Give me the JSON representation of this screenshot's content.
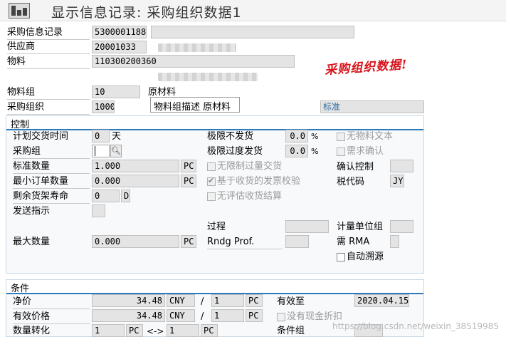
{
  "window": {
    "title": "显示信息记录: 采购组织数据1"
  },
  "header": {
    "info_record_label": "采购信息记录",
    "info_record_value": "5300001188",
    "vendor_label": "供应商",
    "vendor_value": "20001033",
    "material_label": "物料",
    "material_value": "110300200360",
    "material_group_label": "物料组",
    "material_group_value": "10",
    "material_group_desc": "原材料",
    "purch_org_label": "采购组织",
    "purch_org_value": "1000",
    "purch_org_type": "标准",
    "annotation": "采购组织数据!",
    "tooltip": "物料组描述 原材料"
  },
  "control": {
    "section_title": "控制",
    "planned_delivery_label": "计划交货时间",
    "planned_delivery_value": "0",
    "planned_delivery_unit": "天",
    "purch_group_label": "采购组",
    "purch_group_value": "",
    "standard_qty_label": "标准数量",
    "standard_qty_value": "1.000",
    "standard_qty_unit": "PC",
    "min_order_label": "最小订单数量",
    "min_order_value": "0.000",
    "min_order_unit": "PC",
    "shelf_life_label": "剩余货架寿命",
    "shelf_life_value": "0",
    "shelf_life_unit": "D",
    "shipping_instr_label": "发送指示",
    "underdelivery_label": "极限不发货",
    "underdelivery_value": "0.0",
    "underdelivery_unit": "%",
    "overdelivery_label": "极限过度发货",
    "overdelivery_value": "0.0",
    "overdelivery_unit": "%",
    "unlimited_label": "无限制过量交货",
    "gr_based_iv_label": "基于收货的发票校验",
    "no_ers_label": "无评估收货结算",
    "no_material_text_label": "无物料文本",
    "ack_required_label": "需求确认",
    "conf_control_label": "确认控制",
    "tax_code_label": "税代码",
    "tax_code_value": "JY",
    "procedure_label": "过程",
    "rndg_prof_label": "Rndg Prof.",
    "uom_group_label": "计量单位组",
    "rma_label": "需 RMA",
    "auto_source_label": "自动溯源",
    "max_qty_label": "最大数量",
    "max_qty_value": "0.000",
    "max_qty_unit": "PC"
  },
  "conditions": {
    "section_title": "条件",
    "net_price_label": "净价",
    "net_price_value": "34.48",
    "net_price_currency": "CNY",
    "net_price_per": "1",
    "net_price_per_unit": "PC",
    "valid_to_label": "有效至",
    "valid_to_value": "2020.04.15",
    "eff_price_label": "有效价格",
    "eff_price_value": "34.48",
    "eff_price_currency": "CNY",
    "eff_price_per": "1",
    "eff_price_per_unit": "PC",
    "no_cash_disc_label": "没有现金折扣",
    "qty_conv_label": "数量转化",
    "qty_conv_left": "1",
    "qty_conv_left_unit": "PC",
    "qty_conv_arrow": "<->",
    "qty_conv_right": "1",
    "qty_conv_right_unit": "PC",
    "cond_group_label": "条件组",
    "slash": "/"
  },
  "watermark": "https://blog.csdn.net/weixin_38519985"
}
